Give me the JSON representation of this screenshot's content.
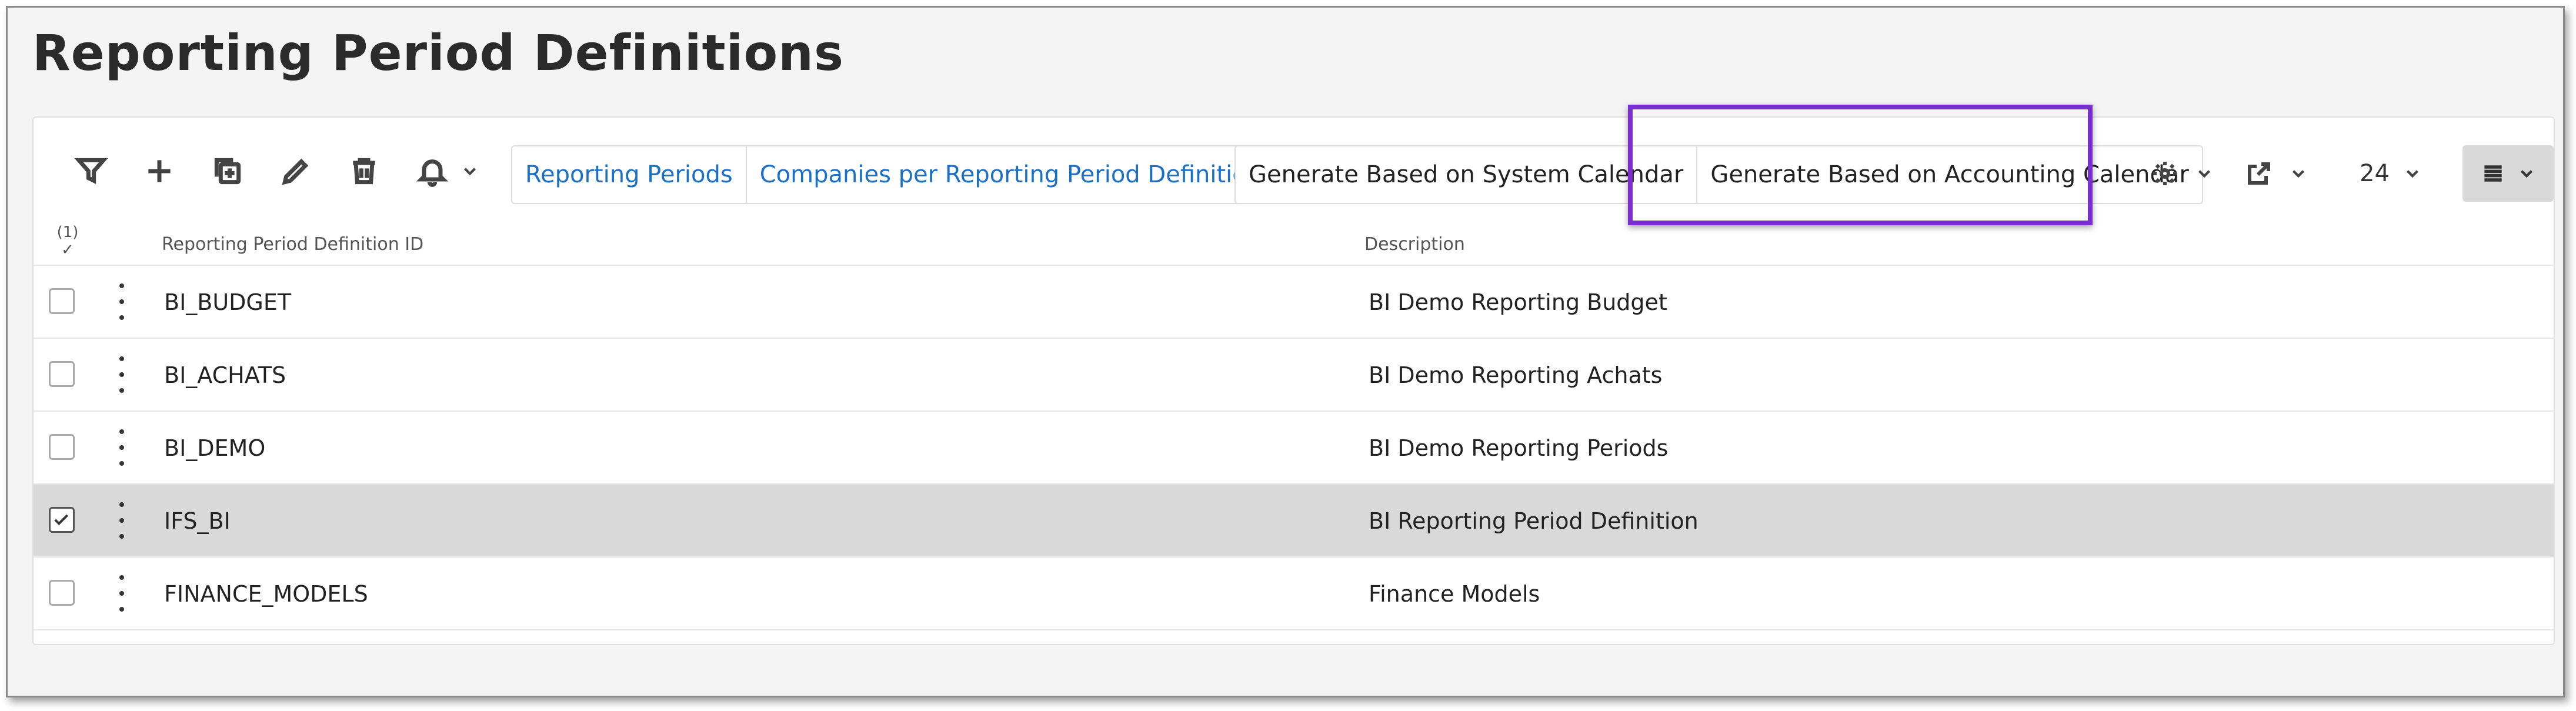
{
  "page": {
    "title": "Reporting Period Definitions"
  },
  "toolbar": {
    "icons": [
      "filter-icon",
      "add-icon",
      "duplicate-icon",
      "edit-icon",
      "delete-icon",
      "bell-icon"
    ],
    "nav_buttons": [
      "Reporting Periods",
      "Companies per Reporting Period Definition ID"
    ],
    "generate_buttons": [
      "Generate Based on System Calendar",
      "Generate Based on Accounting Calendar"
    ],
    "page_size": "24"
  },
  "table": {
    "selected_count": "(1)",
    "columns": [
      "Reporting Period Definition ID",
      "Description"
    ],
    "rows": [
      {
        "id": "BI_BUDGET",
        "description": "BI Demo Reporting Budget",
        "selected": false
      },
      {
        "id": "BI_ACHATS",
        "description": "BI Demo Reporting Achats",
        "selected": false
      },
      {
        "id": "BI_DEMO",
        "description": "BI Demo Reporting Periods",
        "selected": false
      },
      {
        "id": "IFS_BI",
        "description": "BI Reporting Period Definition",
        "selected": true
      },
      {
        "id": "FINANCE_MODELS",
        "description": "Finance Models",
        "selected": false
      }
    ]
  },
  "colors": {
    "highlight": "#7b2fd0",
    "link": "#1a6fc9",
    "selected_row": "#d9d9d9"
  }
}
